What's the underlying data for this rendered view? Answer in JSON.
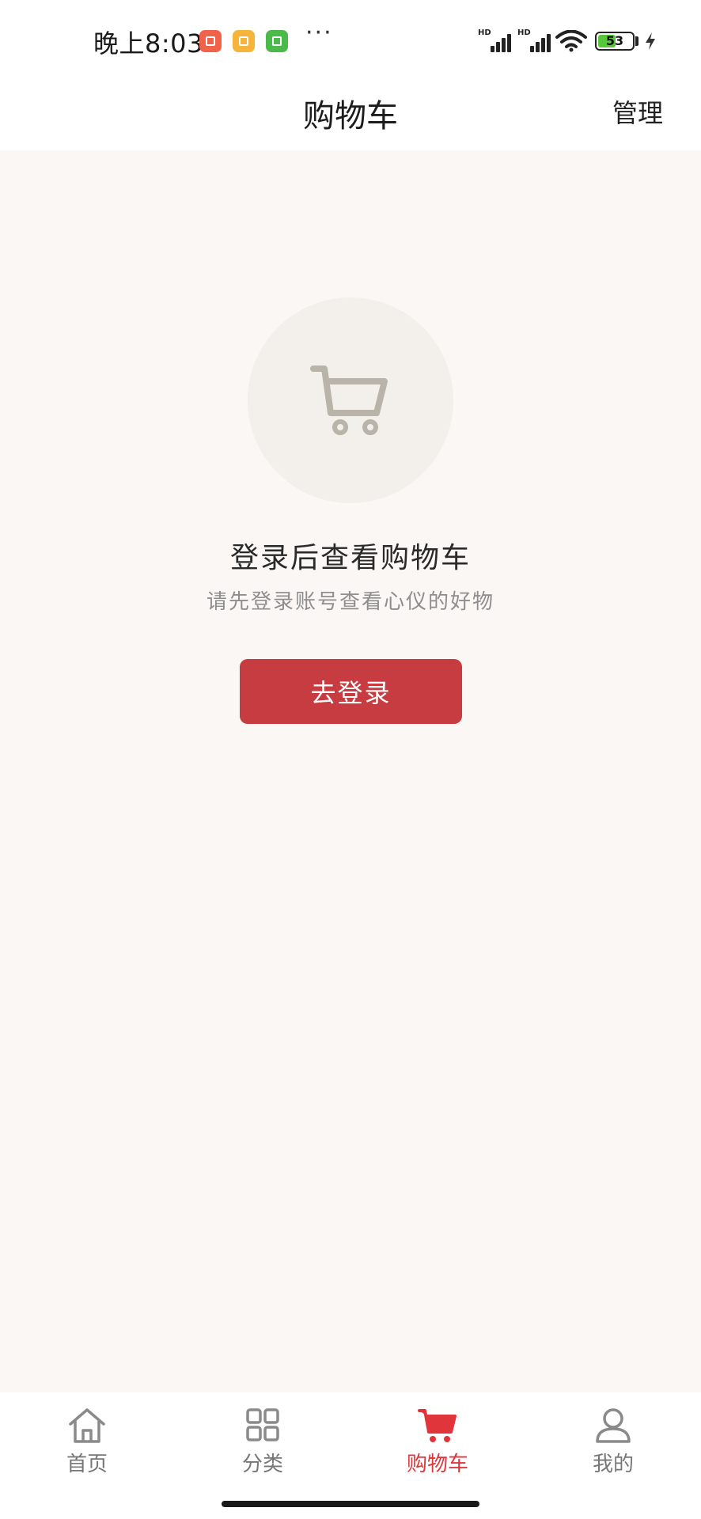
{
  "status_bar": {
    "time": "晚上8:03",
    "more": "···",
    "network_label_1": "HD",
    "network_label_2": "HD",
    "battery": "53",
    "battery_level": 0.53,
    "notification_colors": [
      "#f0624a",
      "#f6b43a",
      "#4cba4a"
    ]
  },
  "header": {
    "title": "购物车",
    "manage_label": "管理"
  },
  "empty_state": {
    "icon": "cart-icon",
    "title": "登录后查看购物车",
    "subtitle": "请先登录账号查看心仪的好物",
    "button_label": "去登录"
  },
  "tab_bar": {
    "items": [
      {
        "label": "首页",
        "icon": "home-icon",
        "active": false
      },
      {
        "label": "分类",
        "icon": "grid-icon",
        "active": false
      },
      {
        "label": "购物车",
        "icon": "cart-icon",
        "active": true
      },
      {
        "label": "我的",
        "icon": "user-icon",
        "active": false
      }
    ],
    "active_color": "#e0353b",
    "inactive_color": "#777777"
  },
  "colors": {
    "accent": "#c73c41",
    "background": "#faf7f4"
  }
}
